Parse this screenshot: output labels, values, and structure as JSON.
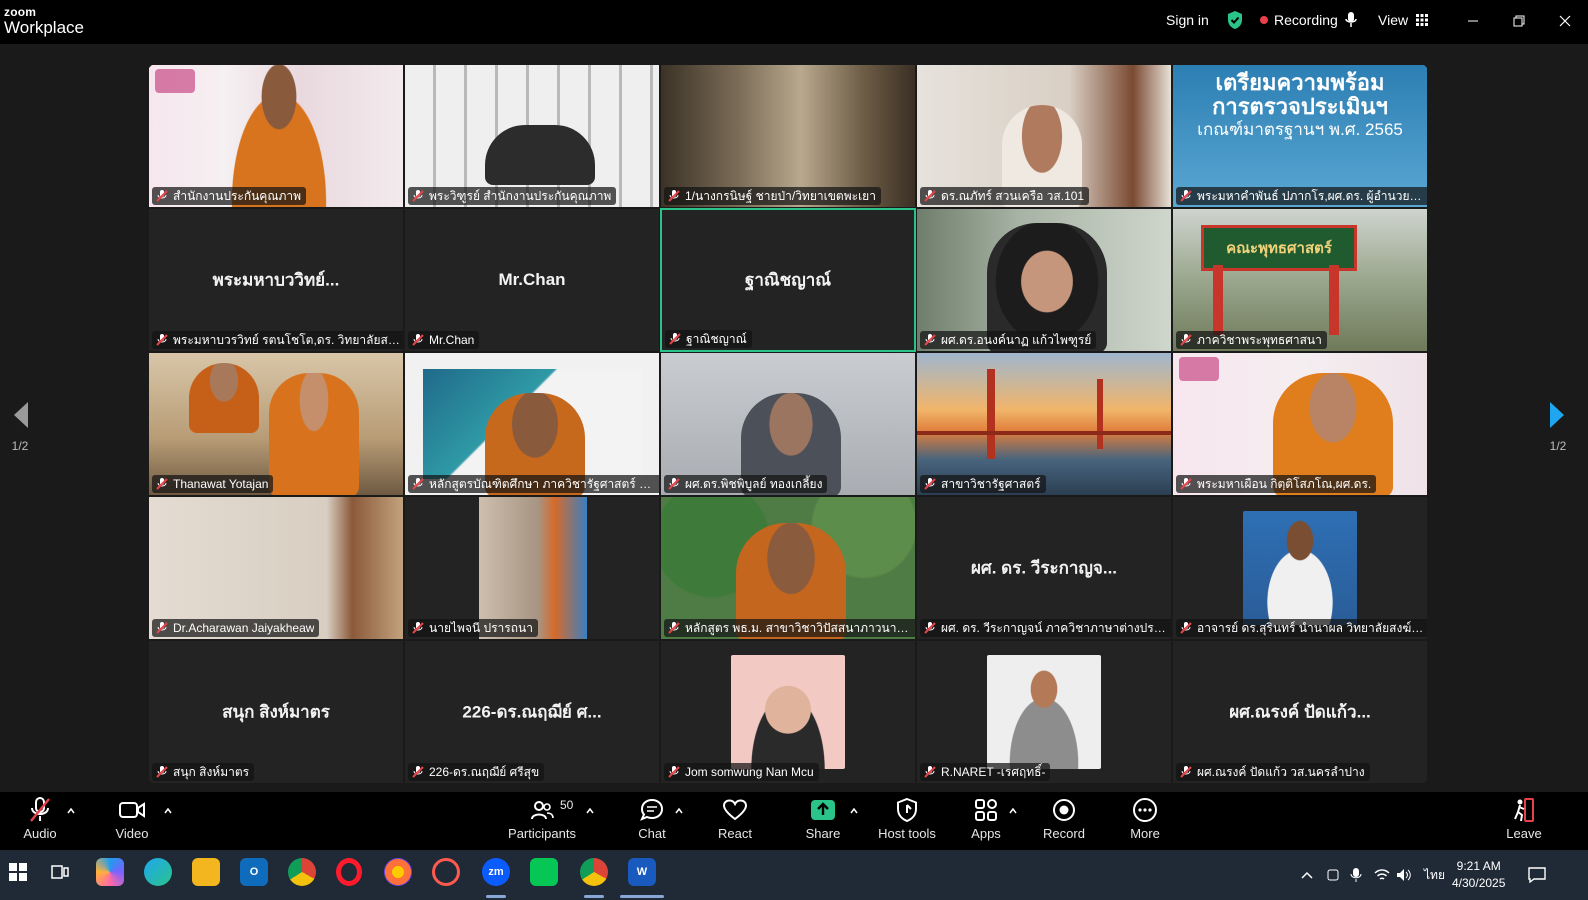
{
  "app": {
    "logo_top": "zoom",
    "logo_bottom": "Workplace"
  },
  "titlebar": {
    "sign_in": "Sign in",
    "recording": "Recording",
    "view": "View"
  },
  "colors": {
    "accent": "#2ac38a",
    "recording_dot": "#e8414a",
    "muted_red": "#e8414a",
    "share_green": "#2ac38a"
  },
  "tiles": [
    {
      "label": "สำนักงานประกันคุณภาพ"
    },
    {
      "label": "พระวิฑูรย์ สำนักงานประกันคุณภาพ"
    },
    {
      "label": "1/นางกรนิษฐ์ ชายป่า/วิทยาเขตพะเยา"
    },
    {
      "label": "ดร.ณภัทร์ สวนเครือ วส.101"
    },
    {
      "label": "พระมหาคำพันธ์ ปภากโร,ผศ.ดร. ผู้อำนวยการ...",
      "slide_line1": "เตรียมความพร้อม",
      "slide_line2": "การตรวจประเมินฯ",
      "slide_line3": "เกณฑ์มาตรฐานฯ พ.ศ. 2565"
    },
    {
      "label": "พระมหาบวรวิทย์ รตนโชโต,ดร. วิทยาลัยสงฆ์น...",
      "display": "พระมหาบววิทย์..."
    },
    {
      "label": "Mr.Chan",
      "display": "Mr.Chan"
    },
    {
      "label": "ฐาณิชญาณ์",
      "display": "ฐาณิชญาณ์"
    },
    {
      "label": "ผศ.ดร.อนงค์นาฏ  แก้วไพฑูรย์"
    },
    {
      "label": "ภาควิชาพระพุทธศาสนา",
      "sign_text": "คณะพุทธศาสตร์"
    },
    {
      "label": "Thanawat Yotajan"
    },
    {
      "label": "หลักสูตรบัณฑิตศึกษา ภาควิชารัฐศาสตร์ คณะ..."
    },
    {
      "label": "ผศ.ดร.พิชพิบูลย์  ทองเกลี้ยง"
    },
    {
      "label": "สาขาวิชารัฐศาสตร์"
    },
    {
      "label": "พระมหาเผือน กิตฺติโสภโณ,ผศ.ดร."
    },
    {
      "label": "Dr.Acharawan Jaiyakheaw"
    },
    {
      "label": "นายไพจนี  ปรารถนา"
    },
    {
      "label": "หลักสูตร พธ.ม. สาขาวิชาวิปัสสนาภาวนาศึกษา"
    },
    {
      "label": "ผศ. ดร. วีระกาญจน์  ภาควิชาภาษาต่างประเทศ",
      "display": "ผศ. ดร. วีระกาญจ..."
    },
    {
      "label": "อาจารย์ ดร.สุรินทร์ นำนาผล วิทยาลัยสงฆ์ร้อ..."
    },
    {
      "label": "สนุก สิงห์มาตร",
      "display": "สนุก สิงห์มาตร"
    },
    {
      "label": "226-ดร.ณฤฌีย์ ศรีสุข",
      "display": "226-ดร.ณฤฌีย์ ศ..."
    },
    {
      "label": "Jom somwung Nan Mcu"
    },
    {
      "label": "R.NARET -เรศฤทธิ์-"
    },
    {
      "label": "ผศ.ณรงค์ ปัดแก้ว วส.นครลำปาง",
      "display": "ผศ.ณรงค์ ปัดแก้ว..."
    }
  ],
  "pager": {
    "left": "1/2",
    "right": "1/2"
  },
  "toolbar": {
    "audio": "Audio",
    "video": "Video",
    "participants": "Participants",
    "participant_count": "50",
    "chat": "Chat",
    "react": "React",
    "share": "Share",
    "host_tools": "Host tools",
    "apps": "Apps",
    "record": "Record",
    "more": "More",
    "leave": "Leave"
  },
  "taskbar": {
    "time": "9:21 AM",
    "date": "4/30/2025",
    "lang": "ไทย",
    "zoom_label": "zm"
  }
}
